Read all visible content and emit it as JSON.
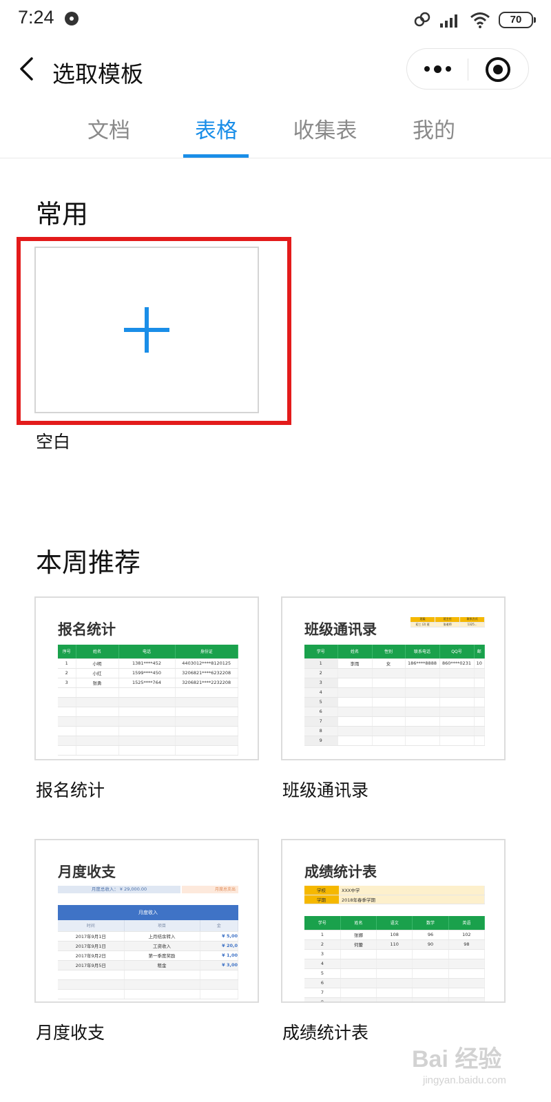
{
  "status_bar": {
    "time": "7:24",
    "battery": "70"
  },
  "nav": {
    "title": "选取模板"
  },
  "tabs": [
    {
      "label": "文档",
      "active": false
    },
    {
      "label": "表格",
      "active": true
    },
    {
      "label": "收集表",
      "active": false
    },
    {
      "label": "我的",
      "active": false
    }
  ],
  "common": {
    "title": "常用",
    "blank_label": "空白"
  },
  "weekly": {
    "title": "本周推荐",
    "templates": [
      {
        "label": "报名统计",
        "thumb_title": "报名统计",
        "headers": [
          "序号",
          "姓名",
          "电话",
          "身份证"
        ],
        "rows": [
          [
            "1",
            "小明",
            "1381****452",
            "4403012****8120125"
          ],
          [
            "2",
            "小红",
            "1599****450",
            "3206821****6232208"
          ],
          [
            "3",
            "张勇",
            "1525****764",
            "3206821****2232208"
          ]
        ]
      },
      {
        "label": "班级通讯录",
        "thumb_title": "班级通讯录",
        "info_headers": [
          "班级",
          "班主任",
          "联系方式"
        ],
        "info_values": [
          "初三 (2) 班",
          "张老师",
          "1325..."
        ],
        "headers": [
          "学号",
          "姓名",
          "性别",
          "联系电话",
          "QQ号",
          "邮"
        ],
        "rows": [
          [
            "1",
            "李雨",
            "女",
            "186****8888",
            "860****0231",
            "10"
          ],
          [
            "2",
            "",
            "",
            "",
            "",
            ""
          ],
          [
            "3",
            "",
            "",
            "",
            "",
            ""
          ],
          [
            "4",
            "",
            "",
            "",
            "",
            ""
          ],
          [
            "5",
            "",
            "",
            "",
            "",
            ""
          ],
          [
            "6",
            "",
            "",
            "",
            "",
            ""
          ],
          [
            "7",
            "",
            "",
            "",
            "",
            ""
          ],
          [
            "8",
            "",
            "",
            "",
            "",
            ""
          ],
          [
            "9",
            "",
            "",
            "",
            "",
            ""
          ]
        ]
      },
      {
        "label": "月度收支",
        "thumb_title": "月度收支",
        "income_summary": "月度总收入： ¥ 29,000.00",
        "expense_summary": "月度总支出",
        "band_title": "月度收入",
        "headers": [
          "时间",
          "项目",
          "金"
        ],
        "rows": [
          [
            "2017年9月1日",
            "上月结余转入",
            "¥ 5,00"
          ],
          [
            "2017年9月1日",
            "工资收入",
            "¥ 20,0"
          ],
          [
            "2017年9月2日",
            "第一季度奖励",
            "¥ 1,00"
          ],
          [
            "2017年9月5日",
            "租金",
            "¥ 3,00"
          ]
        ]
      },
      {
        "label": "成绩统计表",
        "thumb_title": "成绩统计表",
        "school_label": "学校",
        "school_value": "XXX中学",
        "term_label": "学期",
        "term_value": "2018年春季学期",
        "headers": [
          "学号",
          "姓名",
          "语文",
          "数学",
          "英语"
        ],
        "rows": [
          [
            "1",
            "张娜",
            "108",
            "96",
            "102"
          ],
          [
            "2",
            "何蕾",
            "110",
            "90",
            "98"
          ],
          [
            "3",
            "",
            "",
            "",
            ""
          ],
          [
            "4",
            "",
            "",
            "",
            ""
          ],
          [
            "5",
            "",
            "",
            "",
            ""
          ],
          [
            "6",
            "",
            "",
            "",
            ""
          ],
          [
            "7",
            "",
            "",
            "",
            ""
          ],
          [
            "8",
            "",
            "",
            "",
            ""
          ]
        ]
      }
    ]
  },
  "watermark": {
    "main": "Bai 经验",
    "sub": "jingyan.baidu.com"
  },
  "colors": {
    "accent": "#1a8ee8",
    "highlight": "#e31b1b",
    "sheet_green": "#1aa14c",
    "sheet_blue": "#3f73c6"
  }
}
